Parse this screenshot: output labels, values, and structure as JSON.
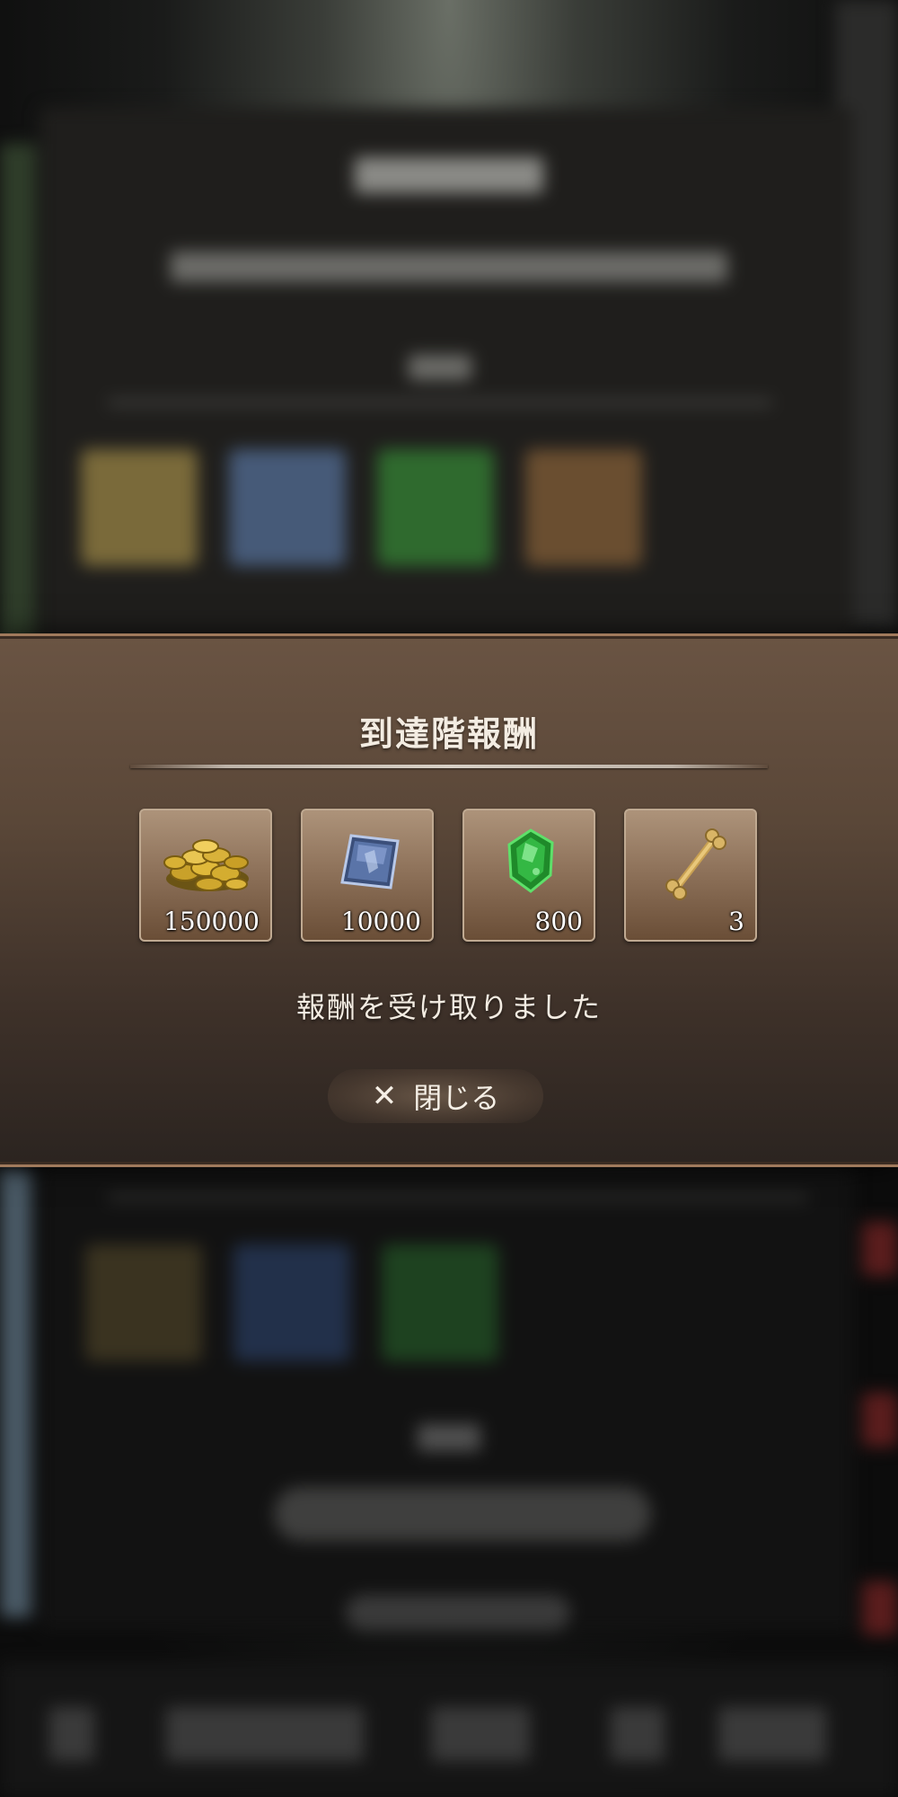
{
  "dialog": {
    "title": "到達階報酬",
    "status_message": "報酬を受け取りました",
    "close_label": "閉じる",
    "close_icon": "close-icon",
    "rewards": [
      {
        "icon": "gold-coins-icon",
        "quantity": "150000"
      },
      {
        "icon": "blue-crystal-icon",
        "quantity": "10000"
      },
      {
        "icon": "green-gem-icon",
        "quantity": "800"
      },
      {
        "icon": "bone-icon",
        "quantity": "3"
      }
    ]
  },
  "colors": {
    "dialog_border": "#a07a5c",
    "dialog_bg_top": "#6a5443",
    "dialog_bg_bottom": "#2b2420",
    "text": "#f3ece2"
  }
}
